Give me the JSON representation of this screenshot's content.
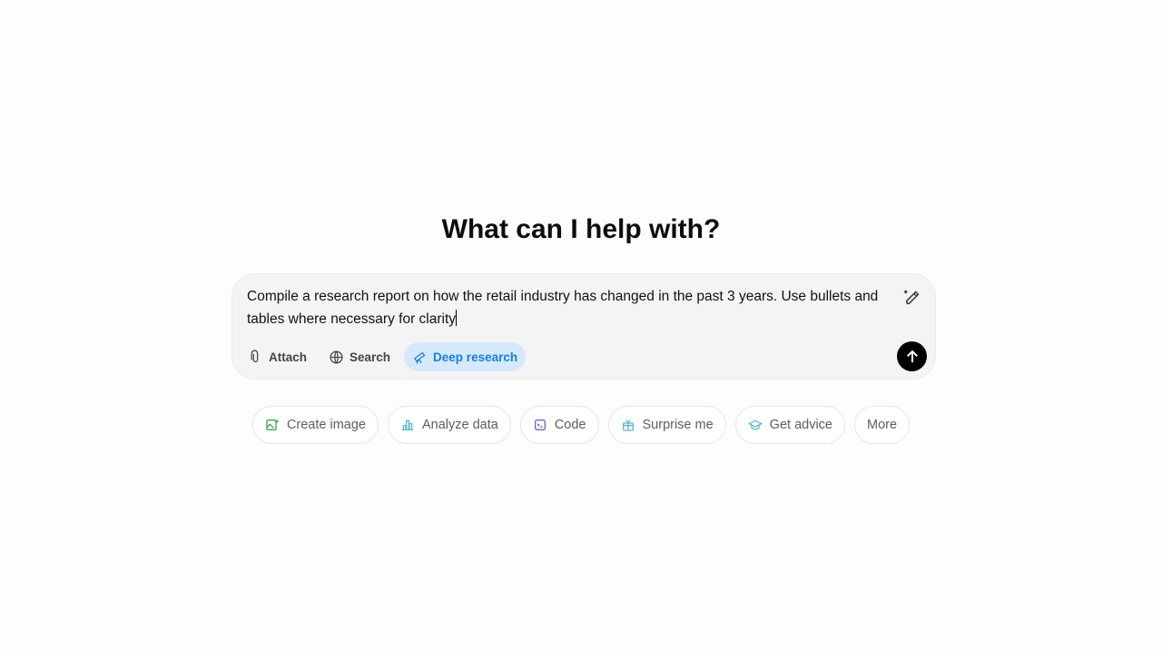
{
  "heading": "What can I help with?",
  "composer": {
    "prompt": "Compile a research report on how the retail industry has changed in the past 3 years. Use bullets and tables where necessary for clarity",
    "tools": [
      {
        "label": "Attach",
        "icon": "paperclip-icon"
      },
      {
        "label": "Search",
        "icon": "globe-icon"
      },
      {
        "label": "Deep research",
        "icon": "telescope-icon",
        "active": true
      }
    ],
    "send_icon": "arrow-up-icon"
  },
  "chips": [
    {
      "label": "Create image",
      "icon": "image-icon",
      "color": "#3aa757"
    },
    {
      "label": "Analyze data",
      "icon": "bar-chart-icon",
      "color": "#5bb8d8"
    },
    {
      "label": "Code",
      "icon": "terminal-icon",
      "color": "#7b61c9"
    },
    {
      "label": "Surprise me",
      "icon": "gift-icon",
      "color": "#5bb8d8"
    },
    {
      "label": "Get advice",
      "icon": "graduation-cap-icon",
      "color": "#5bb8d8"
    },
    {
      "label": "More"
    }
  ],
  "colors": {
    "accent": "#1a7ee0",
    "active_bg": "#d5e9fc"
  }
}
